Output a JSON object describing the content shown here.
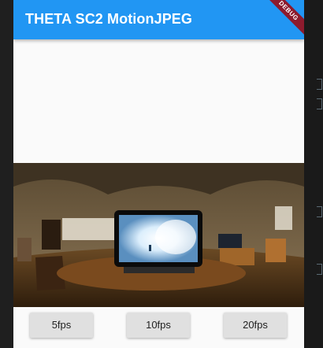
{
  "app_bar": {
    "title": "THETA SC2 MotionJPEG",
    "debug_banner": "DEBUG",
    "color": "#2196f3"
  },
  "preview": {
    "icon": "panorama-image"
  },
  "controls": {
    "buttons": [
      {
        "label": "5fps"
      },
      {
        "label": "10fps"
      },
      {
        "label": "20fps"
      }
    ]
  }
}
